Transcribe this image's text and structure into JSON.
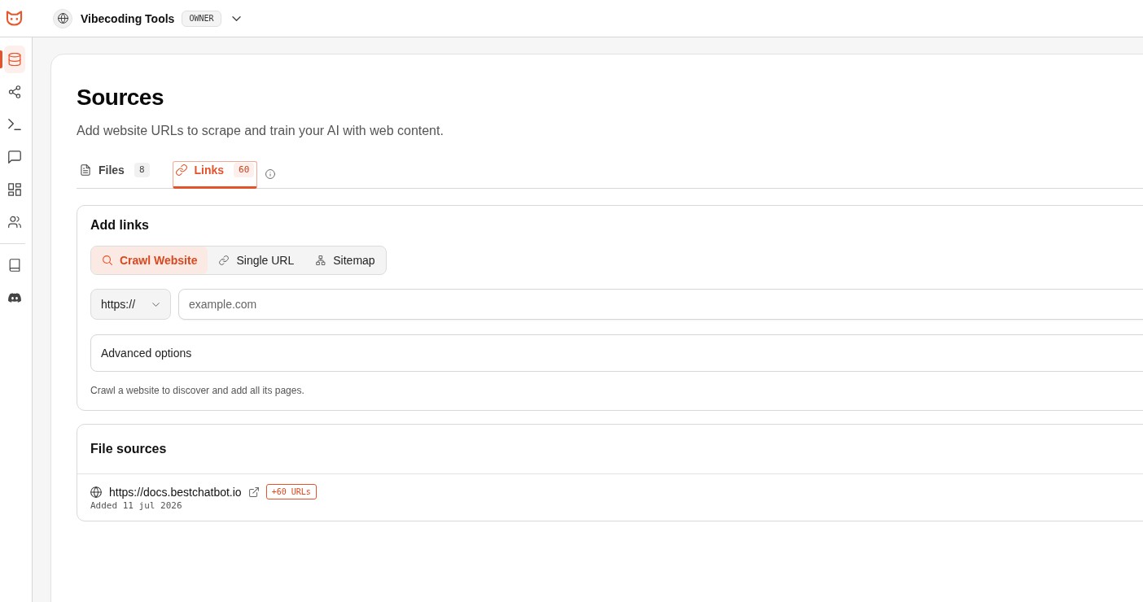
{
  "header": {
    "workspace": "Vibecoding Tools",
    "role_badge": "OWNER"
  },
  "sidebar": {
    "main_items": [
      {
        "selected": true
      },
      {
        "selected": false
      },
      {
        "selected": false
      },
      {
        "selected": false
      },
      {
        "selected": false
      },
      {
        "selected": false
      }
    ],
    "bottom_items": [
      {
        "selected": false
      },
      {
        "selected": false
      }
    ]
  },
  "page": {
    "title": "Sources",
    "subtitle": "Add website URLs to scrape and train your AI with web content."
  },
  "tabs": [
    {
      "label": "Files",
      "count": "8",
      "selected": false
    },
    {
      "label": "Links",
      "count": "60",
      "selected": true
    }
  ],
  "add_links": {
    "title": "Add links",
    "modes": [
      {
        "label": "Crawl Website",
        "selected": true
      },
      {
        "label": "Single URL",
        "selected": false
      },
      {
        "label": "Sitemap",
        "selected": false
      }
    ],
    "protocol": "https://",
    "url_field": {
      "placeholder": "example.com"
    },
    "advanced_options": "Advanced options",
    "hint": "Crawl a website to discover and add all its pages."
  },
  "file_sources": {
    "title": "File sources",
    "items": [
      {
        "url": "https://docs.bestchatbot.io",
        "badge": "+60 URLs",
        "added": "Added 11 jul 2026"
      }
    ]
  }
}
